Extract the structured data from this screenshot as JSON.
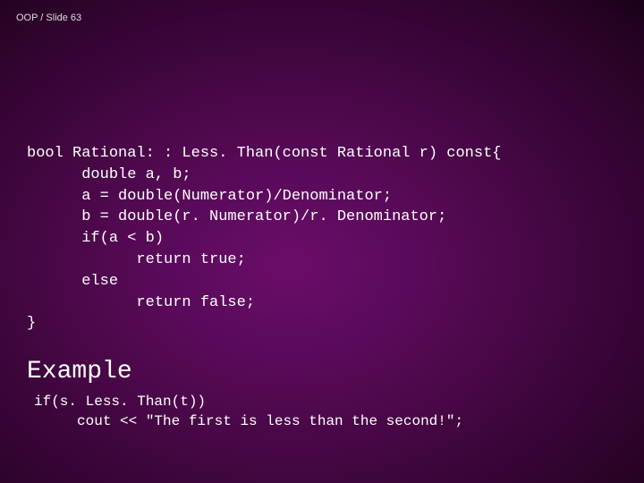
{
  "header": {
    "text": "OOP / Slide 63"
  },
  "code": {
    "line1": "bool Rational: : Less. Than(const Rational r) const{",
    "line2": "      double a, b;",
    "line3": "      a = double(Numerator)/Denominator;",
    "line4": "      b = double(r. Numerator)/r. Denominator;",
    "line5": "      if(a < b)",
    "line6": "            return true;",
    "line7": "      else",
    "line8": "            return false;",
    "line9": "}"
  },
  "example": {
    "label": "Example",
    "line1": "if(s. Less. Than(t))",
    "line2": "     cout << \"The first is less than the second!\";"
  }
}
